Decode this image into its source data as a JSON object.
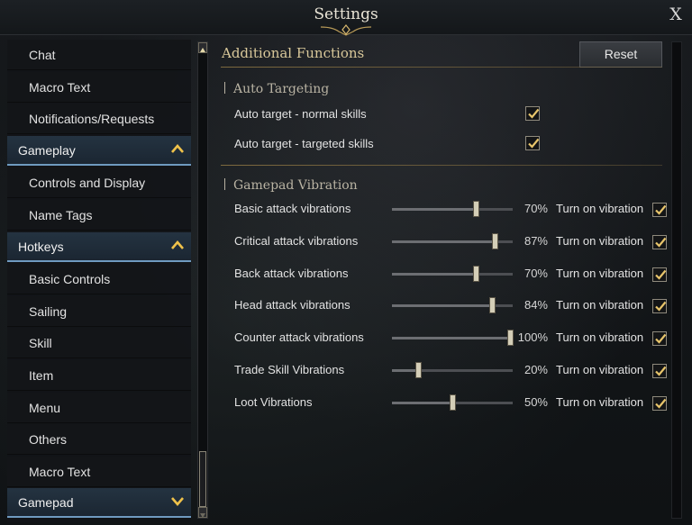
{
  "window": {
    "title": "Settings",
    "close_label": "X"
  },
  "sidebar": {
    "items": [
      {
        "type": "item",
        "label": "Chat"
      },
      {
        "type": "item",
        "label": "Macro Text"
      },
      {
        "type": "item",
        "label": "Notifications/Requests"
      },
      {
        "type": "category",
        "label": "Gameplay",
        "expanded": true
      },
      {
        "type": "item",
        "label": "Controls and Display"
      },
      {
        "type": "item",
        "label": "Name Tags"
      },
      {
        "type": "category",
        "label": "Hotkeys",
        "expanded": true
      },
      {
        "type": "item",
        "label": "Basic Controls"
      },
      {
        "type": "item",
        "label": "Sailing"
      },
      {
        "type": "item",
        "label": "Skill"
      },
      {
        "type": "item",
        "label": "Item"
      },
      {
        "type": "item",
        "label": "Menu"
      },
      {
        "type": "item",
        "label": "Others"
      },
      {
        "type": "item",
        "label": "Macro Text"
      },
      {
        "type": "category",
        "label": "Gamepad",
        "expanded": false
      }
    ]
  },
  "main": {
    "section_title": "Additional Functions",
    "reset_label": "Reset",
    "auto_targeting": {
      "title": "Auto Targeting",
      "options": [
        {
          "label": "Auto target - normal skills",
          "checked": true
        },
        {
          "label": "Auto target - targeted skills",
          "checked": true
        }
      ]
    },
    "gamepad_vibration": {
      "title": "Gamepad Vibration",
      "toggle_label": "Turn on vibration",
      "rows": [
        {
          "label": "Basic attack vibrations",
          "value": 70,
          "value_text": "70%",
          "enabled": true
        },
        {
          "label": "Critical attack vibrations",
          "value": 87,
          "value_text": "87%",
          "enabled": true
        },
        {
          "label": "Back attack vibrations",
          "value": 70,
          "value_text": "70%",
          "enabled": true
        },
        {
          "label": "Head attack vibrations",
          "value": 84,
          "value_text": "84%",
          "enabled": true
        },
        {
          "label": "Counter attack vibrations",
          "value": 100,
          "value_text": "100%",
          "enabled": true
        },
        {
          "label": "Trade Skill Vibrations",
          "value": 20,
          "value_text": "20%",
          "enabled": true
        },
        {
          "label": "Loot Vibrations",
          "value": 50,
          "value_text": "50%",
          "enabled": true
        }
      ]
    }
  },
  "colors": {
    "accent_gold": "#d9c89a",
    "category_underline": "#6f9ac0",
    "checkmark": "#e8c56b"
  }
}
